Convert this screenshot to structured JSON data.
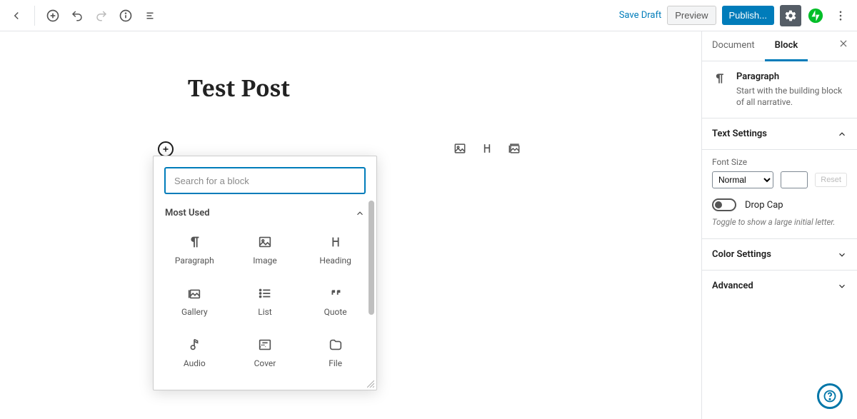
{
  "topbar": {
    "save_draft": "Save Draft",
    "preview": "Preview",
    "publish": "Publish..."
  },
  "post": {
    "title": "Test Post"
  },
  "inserter": {
    "search_placeholder": "Search for a block",
    "section_title": "Most Used",
    "blocks": [
      {
        "label": "Paragraph",
        "icon": "pilcrow"
      },
      {
        "label": "Image",
        "icon": "image"
      },
      {
        "label": "Heading",
        "icon": "heading"
      },
      {
        "label": "Gallery",
        "icon": "gallery"
      },
      {
        "label": "List",
        "icon": "list"
      },
      {
        "label": "Quote",
        "icon": "quote"
      },
      {
        "label": "Audio",
        "icon": "audio"
      },
      {
        "label": "Cover",
        "icon": "cover"
      },
      {
        "label": "File",
        "icon": "file"
      }
    ]
  },
  "sidebar": {
    "tabs": {
      "document": "Document",
      "block": "Block"
    },
    "block_info": {
      "title": "Paragraph",
      "desc": "Start with the building block of all narrative."
    },
    "text_settings": {
      "title": "Text Settings",
      "font_size_label": "Font Size",
      "font_size_value": "Normal",
      "reset": "Reset",
      "drop_cap": "Drop Cap",
      "helper": "Toggle to show a large initial letter."
    },
    "color_settings": "Color Settings",
    "advanced": "Advanced"
  }
}
